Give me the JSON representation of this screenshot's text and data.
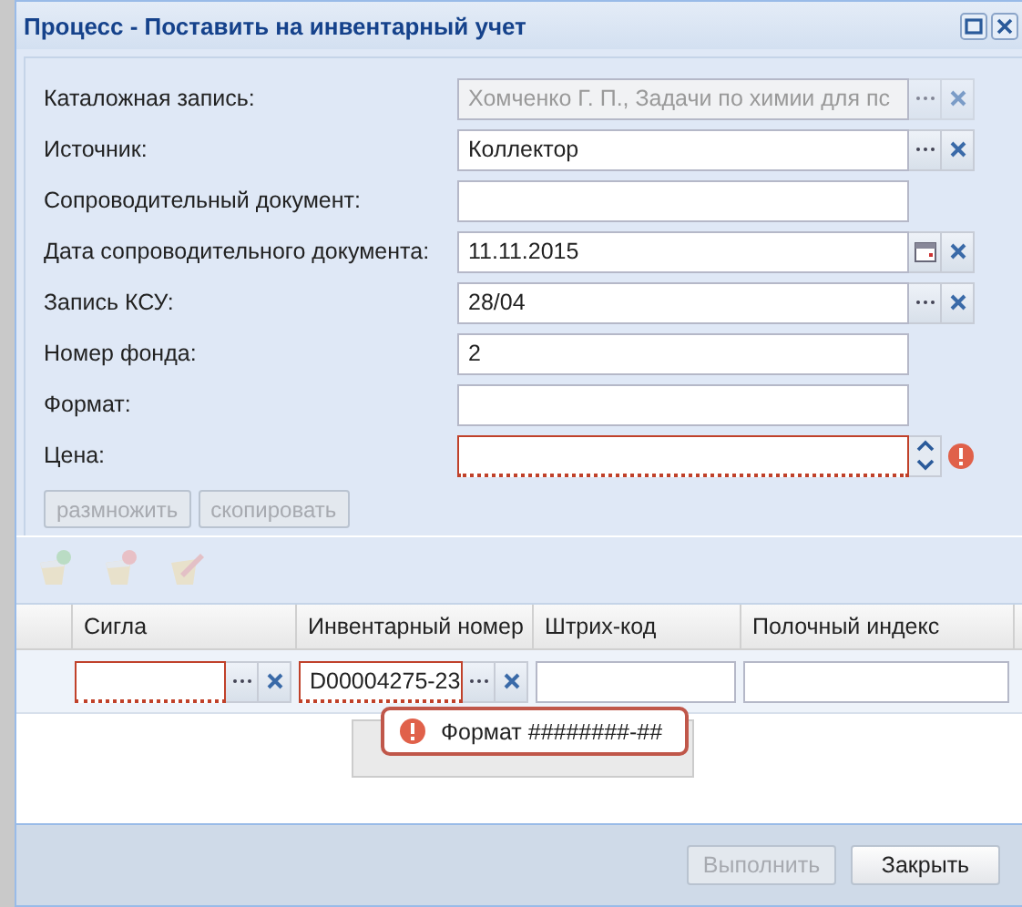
{
  "window": {
    "title": "Процесс - Поставить на инвентарный учет"
  },
  "fields": [
    {
      "label": "Каталожная запись:",
      "kind": "lookup",
      "value": "Хомченко Г. П., Задачи по химии для пс",
      "disabled": true,
      "invalid": false
    },
    {
      "label": "Источник:",
      "kind": "lookup",
      "value": "Коллектор",
      "disabled": false,
      "invalid": false
    },
    {
      "label": "Сопроводительный документ:",
      "kind": "text",
      "disabled": false,
      "invalid": false
    },
    {
      "label": "Дата сопроводительного документа:",
      "kind": "date",
      "value": "11.11.2015",
      "disabled": false,
      "invalid": false
    },
    {
      "label": "Запись КСУ:",
      "kind": "lookup",
      "value": "28/04",
      "disabled": false,
      "invalid": false
    },
    {
      "label": "Номер фонда:",
      "kind": "text",
      "value": "2",
      "disabled": false,
      "invalid": false
    },
    {
      "label": "Формат:",
      "kind": "text",
      "disabled": false,
      "invalid": false
    },
    {
      "label": "Цена:",
      "kind": "number",
      "disabled": false,
      "invalid": true
    }
  ],
  "actions": [
    {
      "label": "размножить",
      "disabled": true
    },
    {
      "label": "скопировать",
      "disabled": true
    }
  ],
  "grid": {
    "columns": [
      "Сигла",
      "Инвентарный номер",
      "Штрих-код",
      "Полочный индекс"
    ],
    "row": [
      {
        "kind": "lookup",
        "invalid": true
      },
      {
        "kind": "lookup",
        "value": "D00004275-23",
        "invalid": true
      },
      {
        "kind": "text",
        "invalid": false
      },
      {
        "kind": "text",
        "invalid": false
      }
    ]
  },
  "tooltip": {
    "text": "Формат ########-##"
  },
  "footer": [
    {
      "label": "Выполнить",
      "disabled": true
    },
    {
      "label": "Закрыть",
      "disabled": false
    }
  ]
}
